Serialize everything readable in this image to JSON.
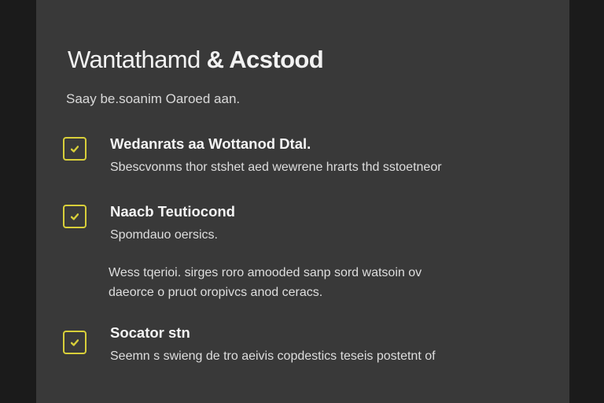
{
  "header": {
    "title_part1": "Wantathamd ",
    "title_part2": "& Acstood",
    "subtitle": "Saay be.soanim Oaroed aan."
  },
  "checklist": {
    "accent_color": "#d8cf3a",
    "items": [
      {
        "checked": true,
        "title": "Wedanrats aa Wottanod Dtal.",
        "description": "Sbescvonms thor stshet aed wewrene hrarts thd sstoetneor"
      },
      {
        "checked": true,
        "title": "Naacb Teutiocond",
        "description": "Spomdauo oersics.",
        "extra_line1": "Wess tqerioi. sirges roro amooded sanp sord watsoin ov",
        "extra_line2": "daeorce o pruot oropivcs anod ceracs."
      },
      {
        "checked": true,
        "title": "Socator stn",
        "description": "Seemn s swieng de tro aeivis copdestics teseis postetnt of"
      }
    ]
  }
}
